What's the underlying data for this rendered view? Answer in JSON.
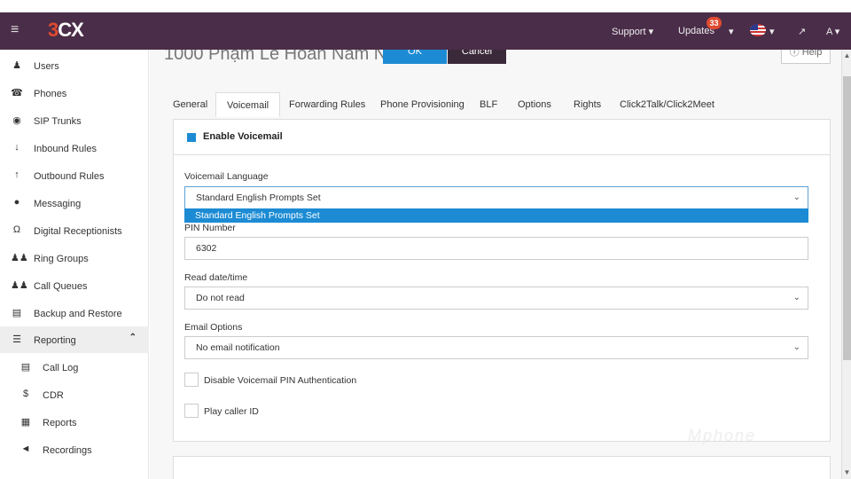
{
  "topbar": {
    "logo_3": "3",
    "logo_cx": "CX",
    "support": "Support ▾",
    "updates": "Updates",
    "updates_badge": "33",
    "user": "A ▾",
    "hamburger_icon": "menu-icon"
  },
  "sidebar": {
    "items": [
      {
        "label": "Users",
        "icon": "user-icon"
      },
      {
        "label": "Phones",
        "icon": "phone-icon"
      },
      {
        "label": "SIP Trunks",
        "icon": "globe-icon"
      },
      {
        "label": "Inbound Rules",
        "icon": "arrow-down-icon"
      },
      {
        "label": "Outbound Rules",
        "icon": "arrow-up-icon"
      },
      {
        "label": "Messaging",
        "icon": "chat-icon"
      },
      {
        "label": "Digital Receptionists",
        "icon": "headset-icon"
      },
      {
        "label": "Ring Groups",
        "icon": "group-icon"
      },
      {
        "label": "Call Queues",
        "icon": "queue-icon"
      },
      {
        "label": "Backup and Restore",
        "icon": "database-icon"
      },
      {
        "label": "Reporting",
        "icon": "list-icon"
      },
      {
        "label": "Call Log",
        "icon": "log-icon"
      },
      {
        "label": "CDR",
        "icon": "dollar-icon"
      },
      {
        "label": "Reports",
        "icon": "report-icon"
      },
      {
        "label": "Recordings",
        "icon": "speaker-icon"
      }
    ]
  },
  "header": {
    "title": "1000 Phạm Lê Hoàn Nam Nam",
    "ok": "OK",
    "cancel": "Cancel",
    "help": "Help"
  },
  "tabs": [
    "General",
    "Voicemail",
    "Forwarding Rules",
    "Phone Provisioning",
    "BLF",
    "Options",
    "Rights",
    "Click2Talk/Click2Meet"
  ],
  "active_tab": "Voicemail",
  "form": {
    "enable_voicemail": "Enable Voicemail",
    "language_label": "Voicemail Language",
    "language_value": "Standard English Prompts Set",
    "language_option": "Standard English Prompts Set",
    "pin_label": "PIN Number",
    "pin_value": "6302",
    "read_label": "Read date/time",
    "read_value": "Do not read",
    "email_label": "Email Options",
    "email_value": "No email notification",
    "disable_pin": "Disable Voicemail PIN Authentication",
    "play_caller": "Play caller ID"
  },
  "watermark": "Mphone"
}
